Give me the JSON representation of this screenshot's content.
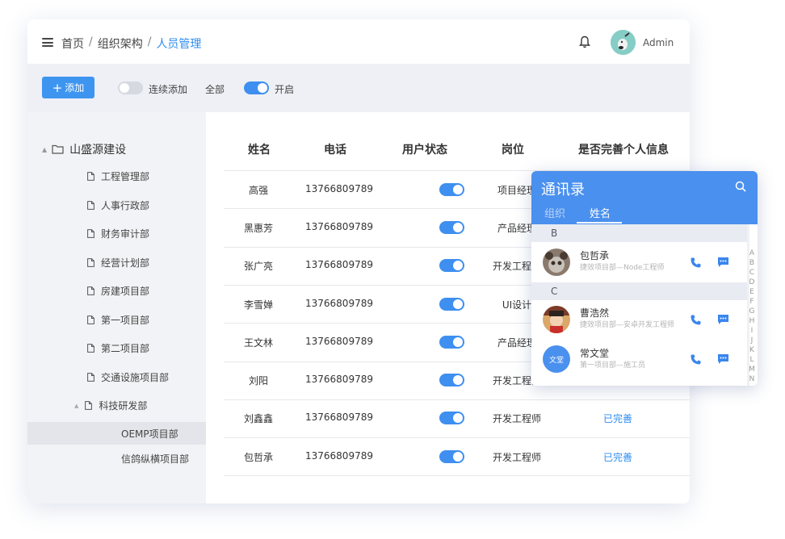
{
  "header": {
    "breadcrumb": [
      "首页",
      "组织架构",
      "人员管理"
    ],
    "user": "Admin"
  },
  "toolbar": {
    "add_label": "添加",
    "continuous_label": "连续添加",
    "all_label": "全部",
    "enable_label": "开启"
  },
  "sidebar": {
    "root": "山盛源建设",
    "items": [
      "工程管理部",
      "人事行政部",
      "财务审计部",
      "经营计划部",
      "房建项目部",
      "第一项目部",
      "第二项目部",
      "交通设施项目部",
      "科技研发部"
    ],
    "subitems": [
      "OEMP项目部",
      "信鸽纵横项目部"
    ]
  },
  "table": {
    "columns": [
      "姓名",
      "电话",
      "用户状态",
      "岗位",
      "是否完善个人信息"
    ],
    "rows": [
      {
        "name": "高强",
        "phone": "13766809789",
        "post": "项目经理",
        "info": ""
      },
      {
        "name": "黑惠芳",
        "phone": "13766809789",
        "post": "产品经理",
        "info": ""
      },
      {
        "name": "张广亮",
        "phone": "13766809789",
        "post": "开发工程师",
        "info": ""
      },
      {
        "name": "李雪婵",
        "phone": "13766809789",
        "post": "UI设计",
        "info": ""
      },
      {
        "name": "王文林",
        "phone": "13766809789",
        "post": "产品经理",
        "info": ""
      },
      {
        "name": "刘阳",
        "phone": "13766809789",
        "post": "开发工程师",
        "info": ""
      },
      {
        "name": "刘鑫鑫",
        "phone": "13766809789",
        "post": "开发工程师",
        "info": "已完善"
      },
      {
        "name": "包哲承",
        "phone": "13766809789",
        "post": "开发工程师",
        "info": "已完善"
      }
    ]
  },
  "contacts": {
    "title": "通讯录",
    "tabs": [
      "组织",
      "姓名"
    ],
    "groups": [
      {
        "letter": "B",
        "people": [
          {
            "name": "包哲承",
            "desc": "捷效项目部—Node工程师"
          }
        ]
      },
      {
        "letter": "C",
        "people": [
          {
            "name": "曹浩然",
            "desc": "捷效项目部—安卓开发工程师"
          },
          {
            "name": "常文堂",
            "desc": "第一项目部—施工员",
            "avatar_text": "文堂"
          }
        ]
      }
    ],
    "alphabet": [
      "A",
      "B",
      "C",
      "D",
      "E",
      "F",
      "G",
      "H",
      "I",
      "J",
      "K",
      "L",
      "M",
      "N"
    ]
  },
  "colors": {
    "accent": "#2e8cf0",
    "header_blue": "#4a90ee"
  }
}
